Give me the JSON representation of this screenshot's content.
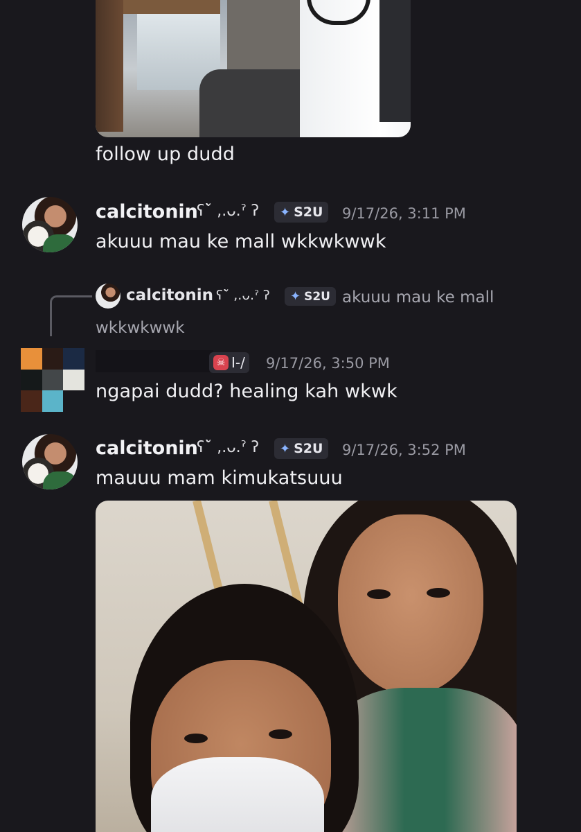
{
  "messages": [
    {
      "text": "follow up dudd"
    },
    {
      "username": "calcitonin",
      "decoration": "ʕ˘̀ ,.ᴗ.ˀ ʔ",
      "tag": "S2U",
      "tag_icon": "butterfly-icon",
      "timestamp": "9/17/26, 3:11 PM",
      "text": "akuuu mau ke mall wkkwkwwk"
    },
    {
      "reply": {
        "username": "calcitonin",
        "decoration": "ʕ˘̀ ,.ᴗ.ˀ ʔ",
        "tag": "S2U",
        "text_line1": "akuuu mau ke mall",
        "text_line2": "wkkwkwwk"
      },
      "role_tag": "I-/",
      "role_icon": "skull-icon",
      "timestamp": "9/17/26, 3:50 PM",
      "text": "ngapai dudd? healing kah wkwk"
    },
    {
      "username": "calcitonin",
      "decoration": "ʕ˘̀ ,.ᴗ.ˀ ʔ",
      "tag": "S2U",
      "tag_icon": "butterfly-icon",
      "timestamp": "9/17/26, 3:52 PM",
      "text": "mauuu mam kimukatsuuu"
    }
  ],
  "colors": {
    "background": "#19181d",
    "text": "#f0f0f3",
    "timestamp": "#9a9aa3",
    "tag_bg": "#2c2c34",
    "butterfly": "#8ab4ff",
    "skull": "#d9434f"
  },
  "pixel_avatar_colors": [
    "#e8903a",
    "#2a1b16",
    "#1b2a44",
    "#15191a",
    "#434749",
    "#e4e4de",
    "#4a2619",
    "#5bb4c9",
    "#19181d"
  ]
}
